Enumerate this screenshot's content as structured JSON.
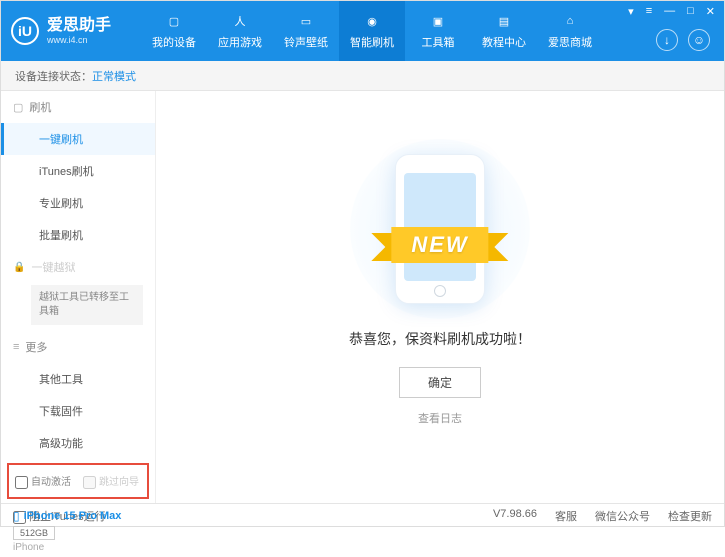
{
  "header": {
    "logo_letter": "iU",
    "app_title": "爱思助手",
    "app_url": "www.i4.cn",
    "nav": [
      {
        "label": "我的设备"
      },
      {
        "label": "应用游戏"
      },
      {
        "label": "铃声壁纸"
      },
      {
        "label": "智能刷机"
      },
      {
        "label": "工具箱"
      },
      {
        "label": "教程中心"
      },
      {
        "label": "爱思商城"
      }
    ]
  },
  "status": {
    "label": "设备连接状态：",
    "mode": "正常模式"
  },
  "sidebar": {
    "section_flash": "刷机",
    "items_flash": [
      "一键刷机",
      "iTunes刷机",
      "专业刷机",
      "批量刷机"
    ],
    "section_jailbreak": "一键越狱",
    "jailbreak_note": "越狱工具已转移至工具箱",
    "section_more": "更多",
    "items_more": [
      "其他工具",
      "下载固件",
      "高级功能"
    ],
    "checkbox_auto_activate": "自动激活",
    "checkbox_skip_guide": "跳过向导"
  },
  "device": {
    "name": "iPhone 15 Pro Max",
    "storage": "512GB",
    "type": "iPhone"
  },
  "main": {
    "ribbon_text": "NEW",
    "success_msg": "恭喜您，保资料刷机成功啦！",
    "ok_button": "确定",
    "view_log": "查看日志"
  },
  "footer": {
    "block_itunes": "阻止iTunes运行",
    "version": "V7.98.66",
    "links": [
      "客服",
      "微信公众号",
      "检查更新"
    ]
  }
}
